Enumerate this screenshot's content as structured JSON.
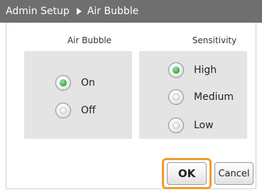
{
  "title": {
    "root": "Admin Setup",
    "page": "Air Bubble"
  },
  "air_bubble": {
    "label": "Air Bubble",
    "options": [
      {
        "label": "On",
        "selected": true
      },
      {
        "label": "Off",
        "selected": false
      }
    ]
  },
  "sensitivity": {
    "label": "Sensitivity",
    "options": [
      {
        "label": "High",
        "selected": true
      },
      {
        "label": "Medium",
        "selected": false
      },
      {
        "label": "Low",
        "selected": false
      }
    ]
  },
  "buttons": {
    "ok": "OK",
    "cancel": "Cancel"
  },
  "colors": {
    "titlebar": "#6f6f6f",
    "selected": "#35b34a",
    "focus_highlight": "#f39a2b"
  }
}
